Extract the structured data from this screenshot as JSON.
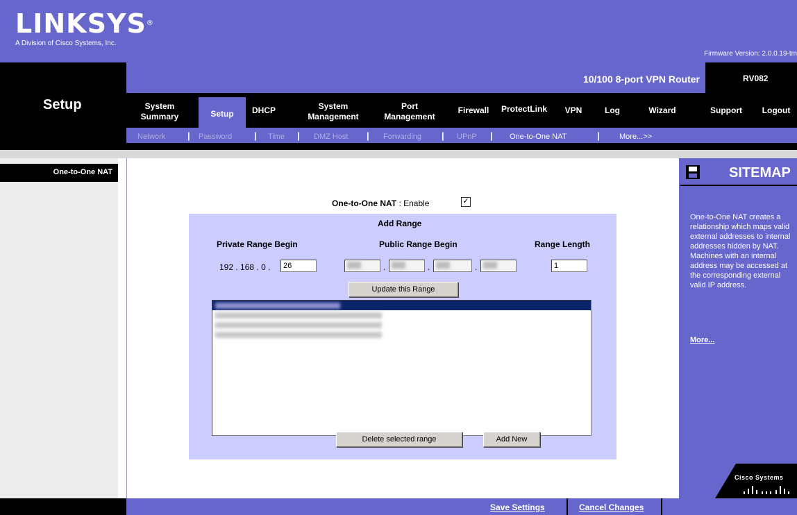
{
  "header": {
    "logo": "LINKSYS",
    "tagline": "A Division of Cisco Systems, Inc.",
    "firmware": "Firmware Version: 2.0.0.19-tm",
    "product_name": "10/100 8-port VPN Router",
    "model": "RV082"
  },
  "section_title": "Setup",
  "tabs": [
    {
      "line1": "System",
      "line2": "Summary"
    },
    {
      "line1": "Setup",
      "line2": ""
    },
    {
      "line1": "DHCP",
      "line2": ""
    },
    {
      "line1": "System",
      "line2": "Management"
    },
    {
      "line1": "Port",
      "line2": "Management"
    },
    {
      "line1": "Firewall",
      "line2": ""
    },
    {
      "line1": "ProtectLink",
      "line2": ""
    },
    {
      "line1": "VPN",
      "line2": ""
    },
    {
      "line1": "Log",
      "line2": ""
    },
    {
      "line1": "Wizard",
      "line2": ""
    },
    {
      "line1": "Support",
      "line2": ""
    },
    {
      "line1": "Logout",
      "line2": ""
    }
  ],
  "subtabs": [
    "Network",
    "Password",
    "Time",
    "DMZ Host",
    "Forwarding",
    "UPnP",
    "One-to-One NAT",
    "More...>>"
  ],
  "left_label": "One-to-One NAT",
  "nat": {
    "enable_label_bold": "One-to-One NAT",
    "enable_label_rest": " : Enable",
    "enabled": true,
    "add_range_title": "Add Range",
    "private_label": "Private Range Begin",
    "public_label": "Public Range Begin",
    "length_label": "Range Length",
    "private_prefix_1": "192",
    "private_prefix_2": "168",
    "private_prefix_3": "0",
    "private_last": "26",
    "range_length": "1",
    "update_button": "Update this Range",
    "delete_button": "Delete selected range",
    "add_button": "Add New"
  },
  "sitemap": {
    "title": "SITEMAP",
    "text": "One-to-One NAT creates a relationship which maps valid external addresses to internal addresses hidden by NAT. Machines with an internal address may be accessed at the corresponding external valid IP address.",
    "more": "More...",
    "cisco": "Cisco Systems"
  },
  "footer": {
    "save": "Save Settings",
    "cancel": "Cancel Changes"
  },
  "colors": {
    "brand_purple": "#6666cc",
    "panel": "#ccccff",
    "selection": "#0a246a"
  }
}
